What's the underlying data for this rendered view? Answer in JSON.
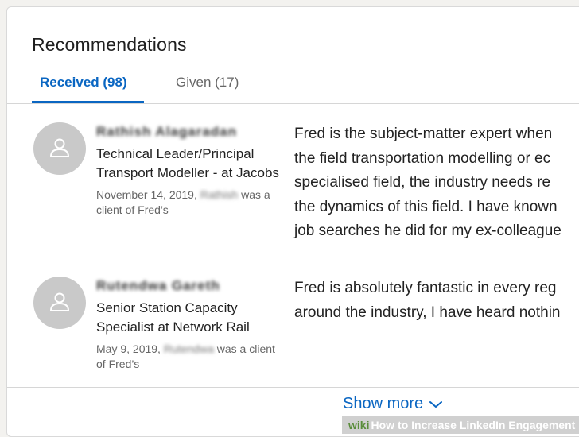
{
  "card": {
    "title": "Recommendations",
    "tabs": [
      {
        "label": "Received (98)"
      },
      {
        "label": "Given (17)"
      }
    ]
  },
  "recommendations": [
    {
      "name": "Rathish Alagaradan",
      "role": "Technical Leader/Principal Transport Modeller - at Jacobs",
      "date": "November 14, 2019,",
      "relation_who": "Rathish",
      "relation": "was a client of Fred’s",
      "text_lines": [
        "Fred is the subject-matter expert when",
        "the field transportation modelling or ec",
        "specialised field, the industry needs re",
        "the dynamics of this field. I have known",
        "job searches he did for my ex-colleague"
      ]
    },
    {
      "name": "Rutendwa Gareth",
      "role": "Senior Station Capacity Specialist at Network Rail",
      "date": "May 9, 2019,",
      "relation_who": "Rutendwa",
      "relation": "was a client of Fred’s",
      "text_lines": [
        "Fred is absolutely fantastic in every reg",
        "around the industry, I have heard nothin"
      ]
    }
  ],
  "footer": {
    "show_more_label": "Show more"
  },
  "watermark": {
    "wiki": "wiki",
    "how": "How",
    "text": "to Increase LinkedIn Engagement"
  },
  "colors": {
    "accent": "#0a66c2",
    "avatar_bg": "#c9c9c9",
    "text": "#222222",
    "muted": "#666666"
  }
}
